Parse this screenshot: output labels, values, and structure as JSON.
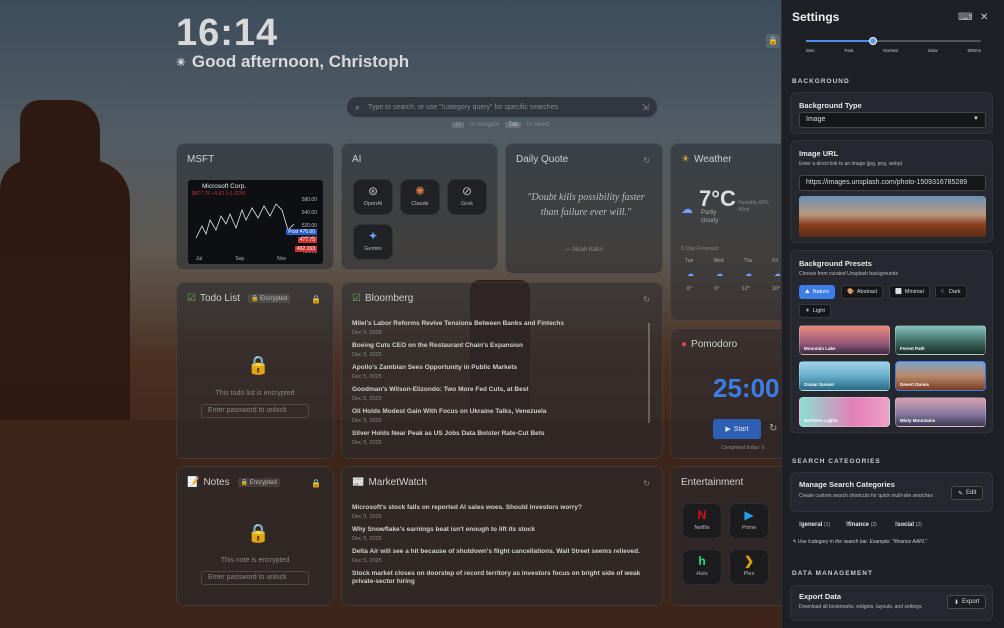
{
  "clock": "16:14",
  "greeting": "Good afternoon, Christoph",
  "search": {
    "placeholder": "Type to search, or use \"!category query\" for specific searches",
    "hint_key1": "↑↓",
    "hint_text1": "to navigate",
    "hint_key2": "Tab",
    "hint_text2": "to select"
  },
  "widgets": {
    "msft": {
      "title": "MSFT",
      "company": "Microsoft Corp.",
      "price_line": "$477.75 +4.82 (+1.02%)",
      "y_ticks": [
        "580.00",
        "540.00",
        "520.00",
        "500.00",
        "480.00"
      ],
      "x_ticks": [
        "Jul",
        "Sep",
        "Nov"
      ],
      "post_label": "Post",
      "post_value": "476.60",
      "price_tag": "477.75",
      "low_tag": "462.163"
    },
    "ai": {
      "title": "AI",
      "apps": [
        "OpenAI",
        "Claude",
        "Grok",
        "Gemini"
      ]
    },
    "quote": {
      "title": "Daily Quote",
      "text": "\"Doubt kills possibility faster than failure ever will.\"",
      "author": "— Noah Kahn"
    },
    "weather": {
      "title": "Weather",
      "temp": "7°C",
      "desc1": "Partly",
      "desc2": "cloudy",
      "extra1": "Humidity 60%",
      "extra2": "Wind",
      "forecast_label": "5 Day Forecast",
      "days": [
        "Tue",
        "Wed",
        "Thu",
        "Fri"
      ],
      "temps": [
        "6°",
        "6°",
        "12°",
        "10°"
      ]
    },
    "todo": {
      "title": "Todo List",
      "encrypted": "Encrypted",
      "msg": "This todo list is encrypted",
      "input": "Enter password to unlock"
    },
    "bloomberg": {
      "title": "Bloomberg",
      "items": [
        {
          "h": "Milei's Labor Reforms Revive Tensions Between Banks and Fintechs",
          "d": "Dec 5, 2025"
        },
        {
          "h": "Boeing Cuts CEO on the Restaurant Chain's Expansion",
          "d": "Dec 5, 2025"
        },
        {
          "h": "Apollo's Zambian Sees Opportunity in Public Markets",
          "d": "Dec 5, 2025"
        },
        {
          "h": "Goodman's Wilson-Elizondo: Two More Fed Cuts, at Best",
          "d": "Dec 5, 2025"
        },
        {
          "h": "Oil Holds Modest Gain With Focus on Ukraine Talks, Venezuela",
          "d": "Dec 5, 2025"
        },
        {
          "h": "Silver Holds Near Peak as US Jobs Data Bolster Rate-Cut Bets",
          "d": "Dec 5, 2025"
        }
      ]
    },
    "pomodoro": {
      "title": "Pomodoro",
      "time": "25:00",
      "start": "Start",
      "sessions": "Completed today: 0"
    },
    "notes": {
      "title": "Notes",
      "encrypted": "Encrypted",
      "msg": "This note is encrypted",
      "input": "Enter password to unlock"
    },
    "marketwatch": {
      "title": "MarketWatch",
      "items": [
        {
          "h": "Microsoft's stock falls on reported AI sales woes. Should investors worry?",
          "d": "Dec 5, 2025"
        },
        {
          "h": "Why Snowflake's earnings beat isn't enough to lift its stock",
          "d": "Dec 5, 2025"
        },
        {
          "h": "Delta Air will see a hit because of shutdown's flight cancellations. Wall Street seems relieved.",
          "d": "Dec 5, 2025"
        },
        {
          "h": "Stock market closes on doorstep of record territory as investors focus on bright side of weak private-sector hiring",
          "d": ""
        }
      ]
    },
    "entertainment": {
      "title": "Entertainment",
      "apps": [
        "Netflix",
        "Prime",
        "Hulu",
        "Plex"
      ]
    }
  },
  "settings": {
    "title": "Settings",
    "speed_ticks": [
      "0ms",
      "Fast",
      "Normal",
      "Slow",
      "600ms"
    ],
    "speed_value": 0.38,
    "background_section": "BACKGROUND",
    "bg_type_label": "Background Type",
    "bg_type_value": "Image",
    "image_url_label": "Image URL",
    "image_url_desc": "Enter a direct link to an image (jpg, png, webp)",
    "image_url_value": "https://images.unsplash.com/photo-1509316785289",
    "presets_label": "Background Presets",
    "presets_desc": "Choose from curated Unsplash backgrounds",
    "preset_tabs": [
      "Nature",
      "Abstract",
      "Minimal",
      "Dark",
      "Light"
    ],
    "preset_thumbs": [
      "Mountain Lake",
      "Forest Path",
      "Ocean Sunset",
      "Desert Dunes",
      "Northern Lights",
      "Misty Mountains"
    ],
    "search_section": "SEARCH CATEGORIES",
    "manage_label": "Manage Search Categories",
    "manage_desc": "Create custom search shortcuts for quick multi-site searches",
    "edit_label": "Edit",
    "categories": [
      {
        "name": "!general",
        "count": "(1)"
      },
      {
        "name": "!finance",
        "count": "(2)"
      },
      {
        "name": "!social",
        "count": "(2)"
      }
    ],
    "category_note": "Use !category in the search bar. Example: \"!finance AAPL\"",
    "data_section": "DATA MANAGEMENT",
    "export_label": "Export Data",
    "export_desc": "Download all bookmarks, widgets, layouts, and settings",
    "export_btn": "Export"
  },
  "colors": {
    "accent": "#3b7ee8",
    "panel": "#1e2026",
    "card": "rgba(40,44,50,.55)"
  }
}
